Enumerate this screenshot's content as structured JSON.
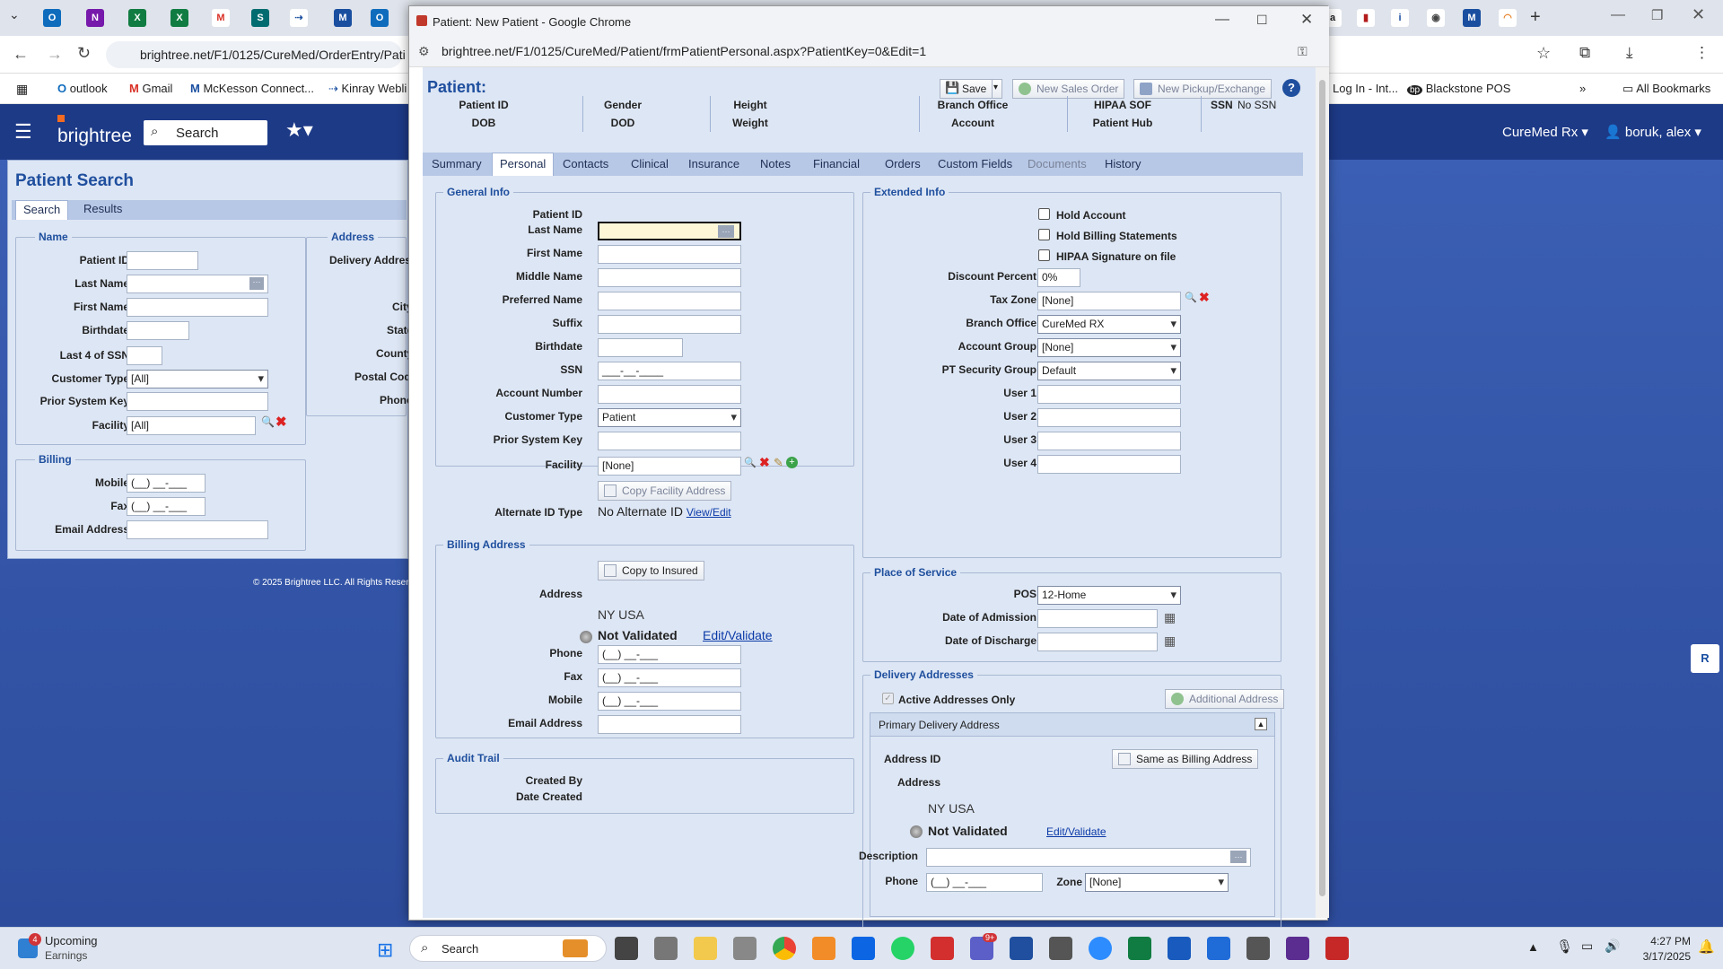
{
  "browser": {
    "bg_url": "brightree.net/F1/0125/CureMed/OrderEntry/Pati",
    "bookmarks": [
      "outlook",
      "Gmail",
      "McKesson Connect...",
      "Kinray Webli",
      "Log In - Int...",
      "Blackstone POS",
      "All Bookmarks"
    ]
  },
  "bt": {
    "logo": "brightree",
    "search": "Search",
    "company": "CureMed Rx",
    "user": "boruk, alex",
    "copyright": "© 2025 Brightree LLC. All Rights Reserv"
  },
  "ps": {
    "title": "Patient Search",
    "tabs": [
      "Search",
      "Results"
    ],
    "name_legend": "Name",
    "address_legend": "Address",
    "billing_legend": "Billing",
    "labels": {
      "patient_id": "Patient ID",
      "last_name": "Last Name",
      "first_name": "First Name",
      "birthdate": "Birthdate",
      "last4": "Last 4 of SSN",
      "customer_type": "Customer Type",
      "prior_key": "Prior System Key",
      "facility": "Facility",
      "delivery": "Delivery Address",
      "city": "City",
      "state": "State",
      "county": "County",
      "postal": "Postal Code",
      "phone": "Phone",
      "mobile": "Mobile",
      "fax": "Fax",
      "email": "Email Address"
    },
    "values": {
      "customer_type": "[All]",
      "facility": "[All]",
      "mobile": "(__) __-___",
      "fax": "(__) __-___"
    }
  },
  "modal": {
    "title": "Patient: New Patient - Google Chrome",
    "url": "brightree.net/F1/0125/CureMed/Patient/frmPatientPersonal.aspx?PatientKey=0&Edit=1",
    "heading": "Patient:",
    "save": "Save",
    "new_sales_order": "New Sales Order",
    "new_pickup": "New Pickup/Exchange",
    "hdr": {
      "patient_id": "Patient ID",
      "dob": "DOB",
      "gender": "Gender",
      "dod": "DOD",
      "height": "Height",
      "weight": "Weight",
      "branch": "Branch Office",
      "account": "Account",
      "hipaa": "HIPAA SOF",
      "hub": "Patient Hub",
      "ssn": "SSN",
      "ssn_val": "No SSN"
    },
    "tabs": [
      "Summary",
      "Personal",
      "Contacts",
      "Clinical",
      "Insurance",
      "Notes",
      "Financial",
      "Orders",
      "Custom Fields",
      "Documents",
      "History"
    ],
    "general": {
      "legend": "General Info",
      "patient_id": "Patient ID",
      "last_name": "Last Name",
      "first_name": "First Name",
      "middle_name": "Middle Name",
      "preferred_name": "Preferred Name",
      "suffix": "Suffix",
      "birthdate": "Birthdate",
      "ssn": "SSN",
      "ssn_val": "___-__-____",
      "account_number": "Account Number",
      "customer_type": "Customer Type",
      "customer_type_val": "Patient",
      "prior_key": "Prior System Key",
      "facility": "Facility",
      "facility_val": "[None]",
      "copy_facility": "Copy Facility Address",
      "alt_id": "Alternate ID Type",
      "alt_id_val": "No Alternate ID",
      "view_edit": "View/Edit"
    },
    "extended": {
      "legend": "Extended Info",
      "hold_account": "Hold Account",
      "hold_billing": "Hold Billing Statements",
      "hipaa_sig": "HIPAA Signature on file",
      "discount": "Discount Percent",
      "discount_val": "0%",
      "tax_zone": "Tax Zone",
      "tax_zone_val": "[None]",
      "branch": "Branch Office",
      "branch_val": "CureMed RX",
      "account_group": "Account Group",
      "account_group_val": "[None]",
      "pt_security": "PT Security Group",
      "pt_security_val": "Default",
      "user1": "User 1",
      "user2": "User 2",
      "user3": "User 3",
      "user4": "User 4"
    },
    "billing": {
      "legend": "Billing Address",
      "copy_insured": "Copy to Insured",
      "address": "Address",
      "address_val": "NY USA",
      "not_validated": "Not Validated",
      "edit_validate": "Edit/Validate",
      "phone": "Phone",
      "fax": "Fax",
      "mobile": "Mobile",
      "email": "Email Address",
      "phone_val": "(__) __-___"
    },
    "audit": {
      "legend": "Audit Trail",
      "created_by": "Created By",
      "date_created": "Date Created"
    },
    "pos": {
      "legend": "Place of Service",
      "pos": "POS",
      "pos_val": "12-Home",
      "admission": "Date of Admission",
      "discharge": "Date of Discharge"
    },
    "delivery": {
      "legend": "Delivery Addresses",
      "active_only": "Active Addresses Only",
      "additional": "Additional Address",
      "primary": "Primary Delivery Address",
      "address_id": "Address ID",
      "same_billing": "Same as Billing Address",
      "address": "Address",
      "address_val": "NY USA",
      "not_validated": "Not Validated",
      "edit_validate": "Edit/Validate",
      "description": "Description",
      "phone": "Phone",
      "phone_val": "(__) __-___",
      "zone": "Zone",
      "zone_val": "[None]"
    }
  },
  "taskbar": {
    "weather1": "Upcoming",
    "weather2": "Earnings",
    "badge": "4",
    "search": "Search",
    "time": "4:27 PM",
    "date": "3/17/2025",
    "badge2": "9+"
  },
  "colors": {
    "bt_navy": "#1d3a87",
    "panel": "#dde6f4",
    "legend": "#1f4f9e"
  }
}
